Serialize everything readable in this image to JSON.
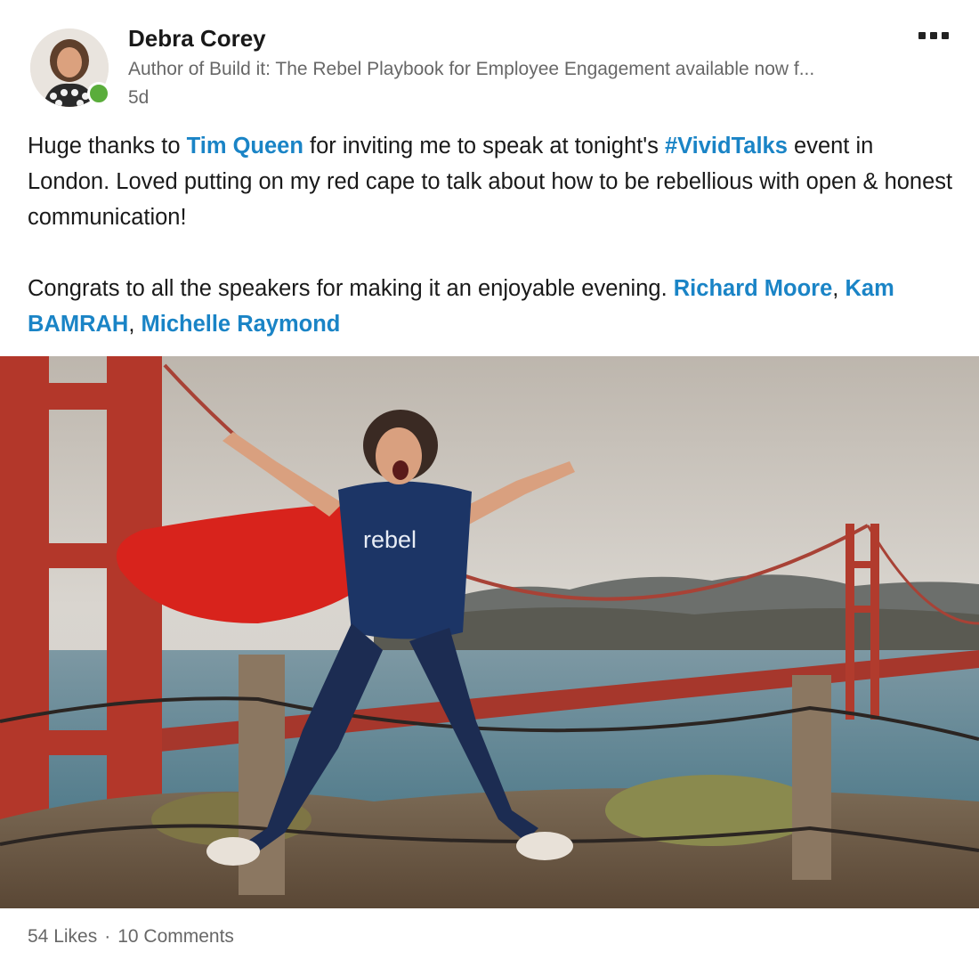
{
  "author": {
    "name": "Debra Corey",
    "headline": "Author of Build it: The Rebel Playbook for Employee Engagement available now f...",
    "age": "5d",
    "presence_color": "#5aad3b"
  },
  "menu": {
    "icon": "more-horizontal-icon"
  },
  "post": {
    "p1": {
      "t1": "Huge thanks to ",
      "m1": "Tim Queen",
      "t2": " for inviting me to speak at tonight's ",
      "hashtag": "#VividTalks",
      "t3": " event in London.  Loved putting on my red cape to talk about how to be rebellious with open & honest communication!"
    },
    "p2": {
      "t1": "Congrats to all the speakers for making it an enjoyable evening. ",
      "m1": "Richard Moore",
      "sep1": ", ",
      "m2": "Kam BAMRAH",
      "sep2": ", ",
      "m3": "Michelle Raymond"
    },
    "shirt_text": "rebel"
  },
  "social": {
    "likes": "54 Likes",
    "separator": "·",
    "comments": "10 Comments"
  },
  "colors": {
    "link": "#1a84c6",
    "bridge": "#b2362a",
    "cape": "#d8231c",
    "outfit": "#1c3566"
  }
}
